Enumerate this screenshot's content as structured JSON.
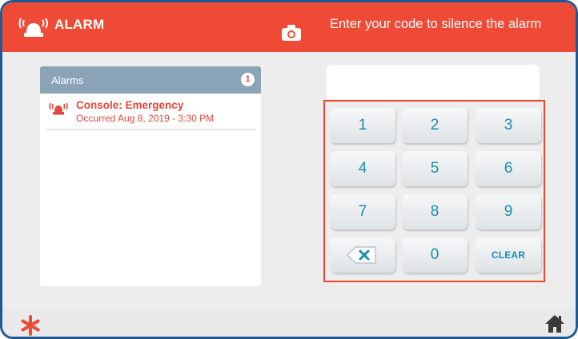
{
  "header": {
    "title": "ALARM",
    "prompt": "Enter your code to silence the alarm",
    "siren_icon": "siren-icon",
    "camera_icon": "camera-icon"
  },
  "alarms_panel": {
    "label": "Alarms",
    "count": "1",
    "items": [
      {
        "name": "Console: Emergency",
        "occurred": "Occurred Aug 8, 2019 - 3:30 PM",
        "icon": "siren-icon"
      }
    ]
  },
  "code_input": {
    "value": "",
    "placeholder": ""
  },
  "keypad": {
    "keys": [
      "1",
      "2",
      "3",
      "4",
      "5",
      "6",
      "7",
      "8",
      "9",
      "",
      "0",
      "CLEAR"
    ],
    "backspace_icon": "backspace-icon"
  },
  "footer": {
    "left_icon": "asterisk-icon",
    "right_icon": "home-icon"
  },
  "colors": {
    "header": "#ef4a35",
    "alarm_text": "#e4473a",
    "keypad_border": "#e9472f",
    "key_text": "#1a8fb0",
    "panel_header": "#8ba3b6",
    "frame_border": "#1f5a93"
  }
}
